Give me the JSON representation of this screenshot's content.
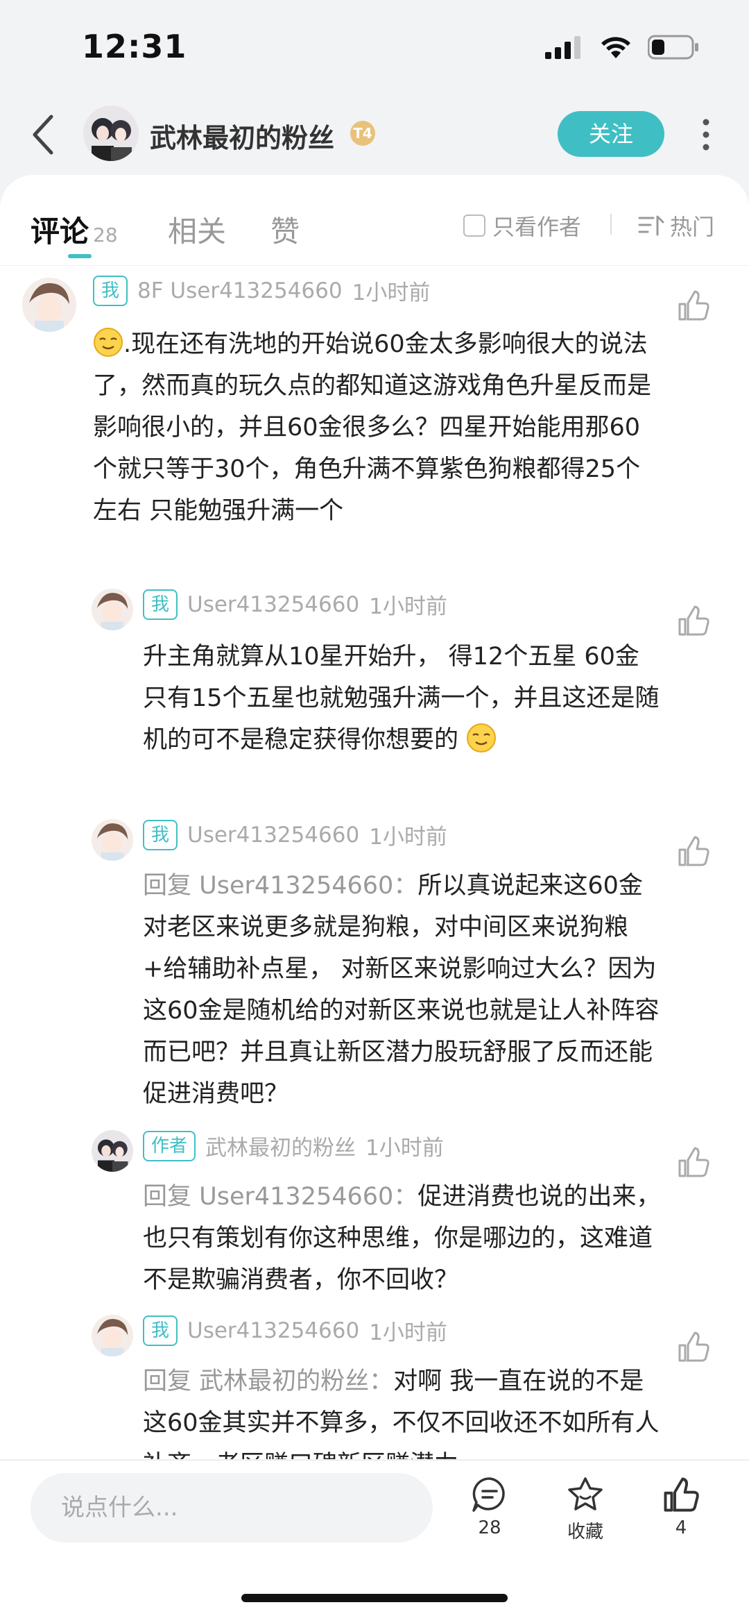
{
  "status": {
    "time": "12:31"
  },
  "header": {
    "author_name": "武林最初的粉丝",
    "level_badge": "T4",
    "follow_label": "关注"
  },
  "tabs": {
    "comments_label": "评论",
    "comments_count": "28",
    "related_label": "相关",
    "likes_label": "赞",
    "only_author_label": "只看作者",
    "sort_label": "热门"
  },
  "comments": [
    {
      "badge": "我",
      "floor_user": "8F User413254660",
      "time": "1小时前",
      "text": ".现在还有洗地的开始说60金太多影响很大的说法了，然而真的玩久点的都知道这游戏角色升星反而是影响很小的，并且60金很多么？四星开始能用那60个就只等于30个，角色升满不算紫色狗粮都得25个左右 只能勉强升满一个"
    },
    {
      "badge": "我",
      "user": "User413254660",
      "time": "1小时前",
      "text": "升主角就算从10星开始升， 得12个五星 60金只有15个五星也就勉强升满一个，并且这还是随机的可不是稳定获得你想要的"
    },
    {
      "badge": "我",
      "user": "User413254660",
      "time": "1小时前",
      "reply_prefix": "回复 User413254660：",
      "text": "所以真说起来这60金对老区来说更多就是狗粮，对中间区来说狗粮+给辅助补点星， 对新区来说影响过大么？因为这60金是随机给的对新区来说也就是让人补阵容而已吧？并且真让新区潜力股玩舒服了反而还能促进消费吧？"
    },
    {
      "badge": "作者",
      "user": "武林最初的粉丝",
      "time": "1小时前",
      "reply_prefix": "回复 User413254660：",
      "text": "促进消费也说的出来，也只有策划有你这种思维，你是哪边的，这难道不是欺骗消费者，你不回收？"
    },
    {
      "badge": "我",
      "user": "User413254660",
      "time": "1小时前",
      "reply_prefix": "回复 武林最初的粉丝：",
      "text": "对啊 我一直在说的不是这60金其实并不算多，不仅不回收还不如所有人补齐，老区赚口碑新区赚潜力"
    }
  ],
  "bottom": {
    "input_placeholder": "说点什么...",
    "comment_count": "28",
    "favorite_label": "收藏",
    "like_count": "4"
  }
}
